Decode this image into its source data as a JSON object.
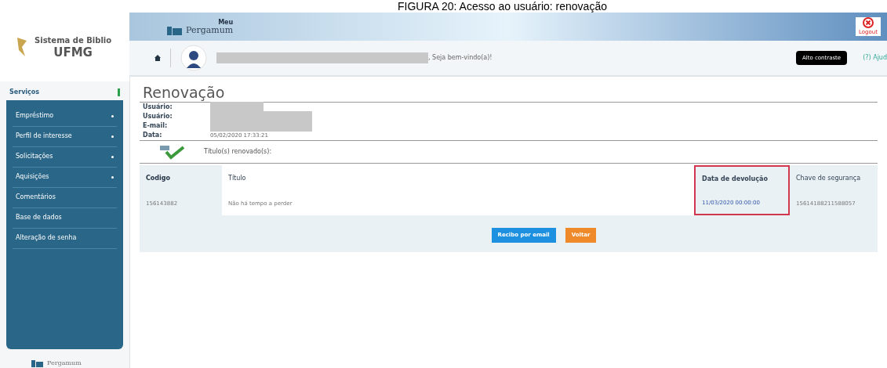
{
  "caption": "FIGURA 20: Acesso ao usuário: renovação",
  "logo": {
    "line_1": "Sistema de Biblio",
    "line_2": "UFMG"
  },
  "banner": {
    "small": "Meu",
    "brand": "Pergamum",
    "logout": "Logout"
  },
  "user_bar": {
    "greeting": ", Seja bem-vindo(a)!",
    "contrast_button": "Alto contraste",
    "help_link": "(?) Ajud"
  },
  "sidebar": {
    "title": "Serviços",
    "items": [
      {
        "label": "Empréstimo",
        "has_submenu": true
      },
      {
        "label": "Perfil de interesse",
        "has_submenu": true
      },
      {
        "label": "Solicitações",
        "has_submenu": true
      },
      {
        "label": "Aquisições",
        "has_submenu": true
      },
      {
        "label": "Comentários",
        "has_submenu": false
      },
      {
        "label": "Base de dados",
        "has_submenu": false
      },
      {
        "label": "Alteração de senha",
        "has_submenu": false
      }
    ],
    "footer_brand": "Pergamum"
  },
  "page": {
    "title": "Renovação",
    "fields": [
      {
        "label": "Usuário:"
      },
      {
        "label": "Usuário:"
      },
      {
        "label": "E-mail:"
      },
      {
        "label": "Data:",
        "value": "05/02/2020 17:33:21"
      }
    ],
    "status": "Título(s) renovado(s):",
    "table": {
      "columns": [
        {
          "label": "Codigo",
          "highlighted": false
        },
        {
          "label": "Título",
          "highlighted": false
        },
        {
          "label": "Data de devolução",
          "highlighted": true
        },
        {
          "label": "Chave de segurança",
          "highlighted": false
        }
      ],
      "rows": [
        [
          "156143882",
          "Não há tempo a perder",
          "11/03/2020 00:00:00",
          "15614188211588057"
        ]
      ]
    },
    "buttons": [
      {
        "label": "Recibo por email",
        "kind": "primary"
      },
      {
        "label": "Voltar",
        "kind": "back"
      }
    ]
  }
}
